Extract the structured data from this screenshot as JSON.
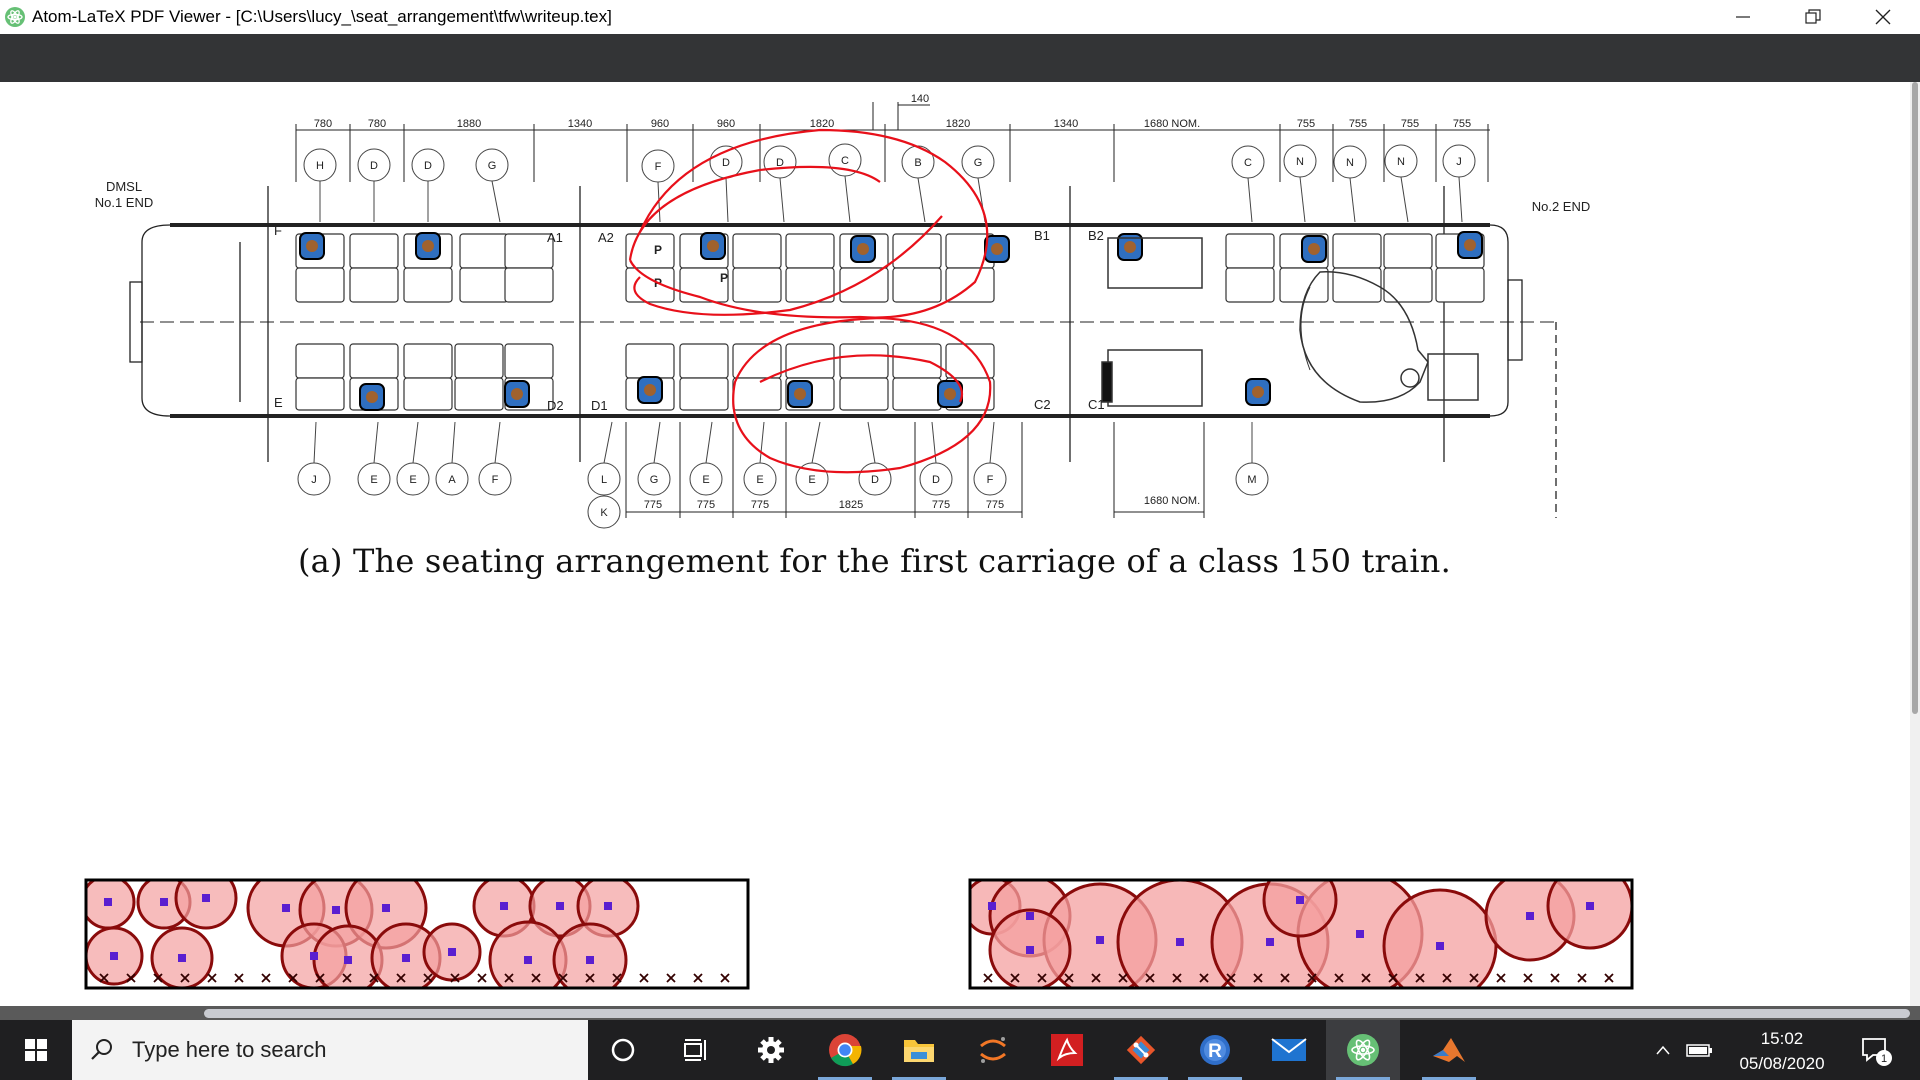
{
  "window": {
    "title": "Atom-LaTeX PDF Viewer - [C:\\Users\\lucy_\\seat_arrangement\\tfw\\writeup.tex]",
    "controls": [
      "minimize-icon",
      "restore-icon",
      "close-icon"
    ]
  },
  "diagram": {
    "end_left_line1": "DMSL",
    "end_left_line2": "No.1 END",
    "end_right": "No.2 END",
    "top_dims": [
      "780",
      "780",
      "1880",
      "1340",
      "960",
      "960",
      "1820",
      "1820",
      "1340",
      "1680 NOM.",
      "755",
      "755",
      "755",
      "755"
    ],
    "top_extra_dim": "140",
    "bottom_dims": [
      "775",
      "775",
      "775",
      "1825",
      "775",
      "775"
    ],
    "bottom_nom": "1680 NOM.",
    "top_circles": [
      "H",
      "D",
      "D",
      "G",
      "F",
      "D",
      "D",
      "C",
      "B",
      "G",
      "C",
      "N",
      "N",
      "N",
      "J"
    ],
    "bottom_circles": [
      "J",
      "E",
      "E",
      "A",
      "F",
      "L",
      "G",
      "E",
      "E",
      "E",
      "D",
      "D",
      "F",
      "M"
    ],
    "extra_circle": "K",
    "door_labels": {
      "f": "F",
      "e": "E",
      "a1": "A1",
      "a2": "A2",
      "b1": "B1",
      "b2": "B2",
      "d2": "D2",
      "d1": "D1",
      "c2": "C2",
      "c1": "C1"
    },
    "p_labels": [
      "P",
      "P",
      "P"
    ]
  },
  "caption": "(a) The seating arrangement for the first carriage of a class 150 train.",
  "colors": {
    "toolbar": "#333436",
    "taskbar": "#1f1f21",
    "annotation_red": "#e8101a",
    "circle_fill": "#f4a0a0",
    "seat_blue": "#2f6fc0",
    "person_brown": "#a0622e",
    "marker_purple": "#5a1fd0"
  },
  "taskbar": {
    "search_placeholder": "Type here to search",
    "time": "15:02",
    "date": "05/08/2020",
    "notification_count": "1",
    "icons": [
      "cortana-icon",
      "task-view-icon",
      "settings-icon",
      "chrome-icon",
      "file-explorer-icon",
      "jupyter-icon",
      "acrobat-icon",
      "git-icon",
      "r-icon",
      "mail-icon",
      "atom-icon",
      "matlab-icon"
    ]
  }
}
